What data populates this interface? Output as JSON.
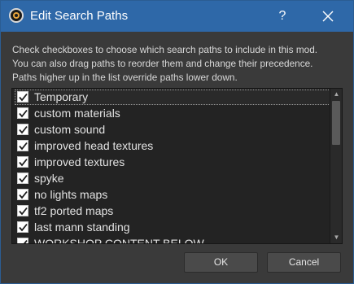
{
  "window": {
    "title": "Edit Search Paths",
    "help_label": "?",
    "icon": "mod-organizer-icon"
  },
  "description": [
    "Check checkboxes to choose which search paths to include in this mod.",
    "You can also drag paths to reorder them and change their precedence.",
    "Paths higher up in the list override paths lower down."
  ],
  "paths": [
    {
      "label": "Temporary",
      "checked": true
    },
    {
      "label": "custom materials",
      "checked": true
    },
    {
      "label": "custom sound",
      "checked": true
    },
    {
      "label": "improved head textures",
      "checked": true
    },
    {
      "label": "improved textures",
      "checked": true
    },
    {
      "label": "spyke",
      "checked": true
    },
    {
      "label": "no lights maps",
      "checked": true
    },
    {
      "label": "tf2 ported maps",
      "checked": true
    },
    {
      "label": "last mann standing",
      "checked": true
    },
    {
      "label": "WORKSHOP CONTENT BELOW",
      "checked": true
    }
  ],
  "buttons": {
    "ok": "OK",
    "cancel": "Cancel"
  },
  "colors": {
    "titlebar": "#2e68a8",
    "background": "#3a3a3a",
    "list_background": "#232323"
  }
}
